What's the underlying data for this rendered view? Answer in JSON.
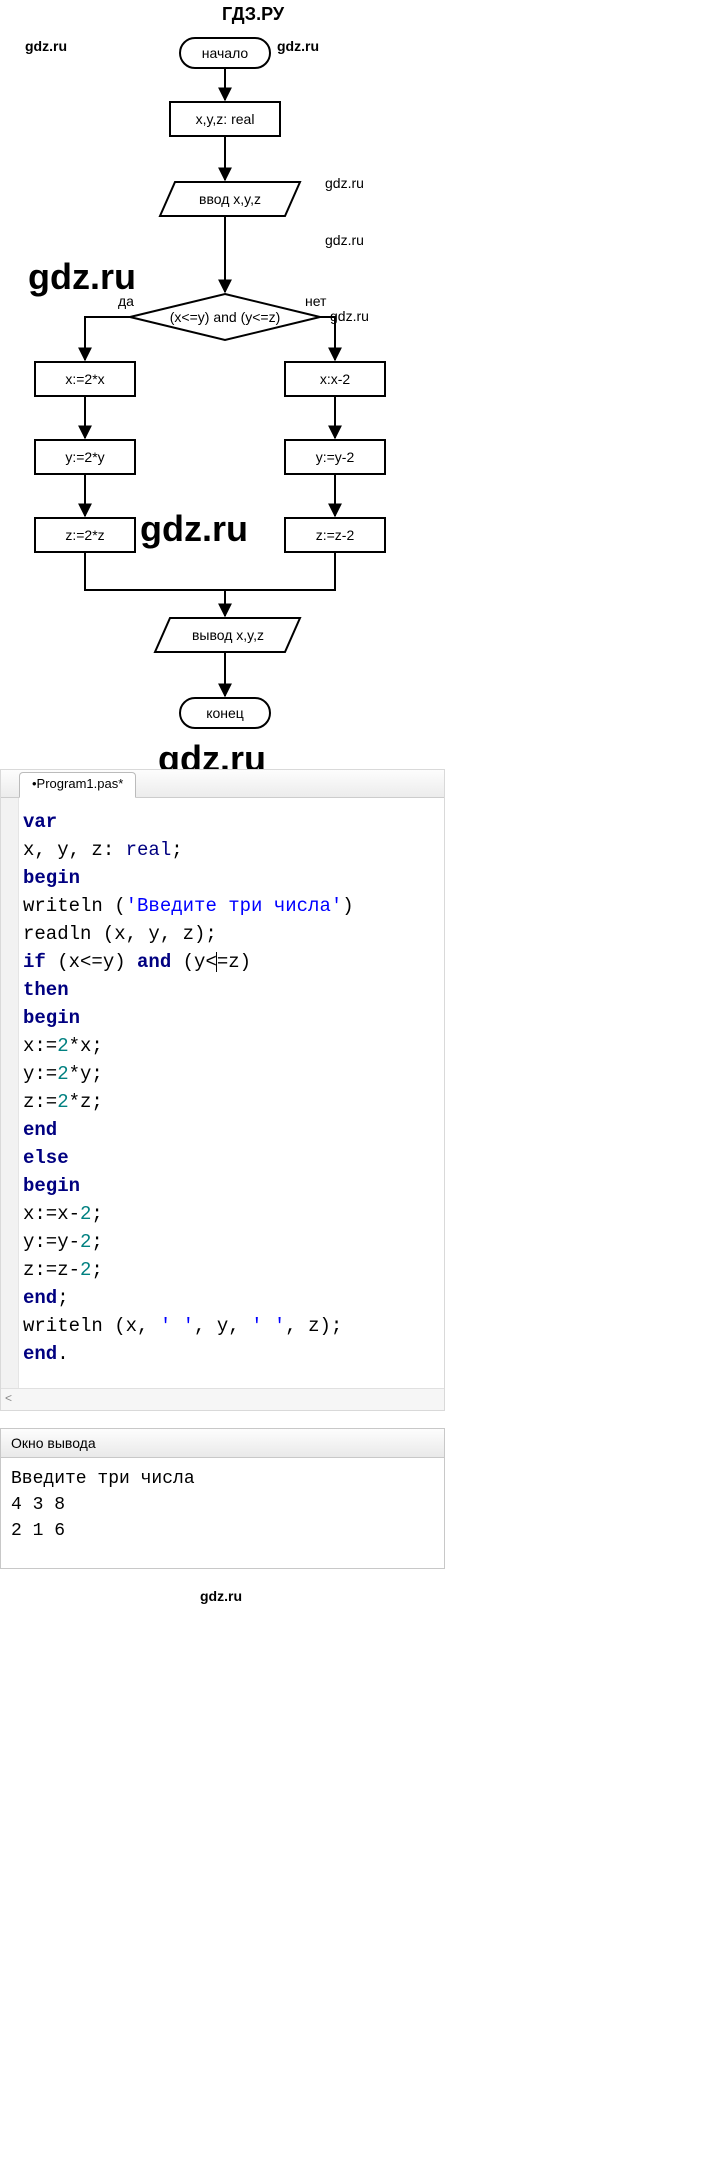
{
  "header": "ГДЗ.РУ",
  "watermarks": {
    "small": "gdz.ru",
    "big": "gdz.ru"
  },
  "flowchart": {
    "start": "начало",
    "decl": "x,y,z: real",
    "input": "ввод x,y,z",
    "cond": "(x<=y) and (y<=z)",
    "yes": "да",
    "no": "нет",
    "yes_branch": [
      "x:=2*x",
      "y:=2*y",
      "z:=2*z"
    ],
    "no_branch": [
      "x:x-2",
      "y:=y-2",
      "z:=z-2"
    ],
    "output": "вывод x,y,z",
    "end": "конец"
  },
  "editor": {
    "tab": "•Program1.pas*",
    "lines": [
      {
        "t": "kw",
        "v": "var"
      },
      {
        "t": "plain",
        "v": "x, y, z: ",
        "tail_ty": "real",
        "tail": ";"
      },
      {
        "t": "kw",
        "v": "begin"
      },
      {
        "t": "plain",
        "v": "writeln (",
        "str": "'Введите три числа'",
        "tail": ")"
      },
      {
        "t": "plain",
        "v": "readln (x, y, z);"
      },
      {
        "t": "if",
        "v": "if",
        "mid": " (x<=y) ",
        "and": "and",
        "mid2": " (y<|",
        "mid3": "=z)"
      },
      {
        "t": "kw",
        "v": "then"
      },
      {
        "t": "kw",
        "v": "begin"
      },
      {
        "t": "assign",
        "v": "x:=",
        "n": "2",
        "tail": "*x;"
      },
      {
        "t": "assign",
        "v": "y:=",
        "n": "2",
        "tail": "*y;"
      },
      {
        "t": "assign",
        "v": "z:=",
        "n": "2",
        "tail": "*z;"
      },
      {
        "t": "kw",
        "v": "end"
      },
      {
        "t": "kw",
        "v": "else"
      },
      {
        "t": "kw",
        "v": "begin"
      },
      {
        "t": "assign",
        "v": "x:=x-",
        "n": "2",
        "tail": ";"
      },
      {
        "t": "assign",
        "v": "y:=y-",
        "n": "2",
        "tail": ";"
      },
      {
        "t": "assign",
        "v": "z:=z-",
        "n": "2",
        "tail": ";"
      },
      {
        "t": "kwsemi",
        "v": "end",
        ";": ";"
      },
      {
        "t": "wr",
        "v": "writeln (x, ",
        "s1": "' '",
        "m1": ", y, ",
        "s2": "' '",
        "m2": ", z);"
      },
      {
        "t": "kwdot",
        "v": "end",
        "dot": "."
      }
    ]
  },
  "output": {
    "title": "Окно вывода",
    "lines": [
      "Введите три числа",
      "4 3 8",
      "2 1 6"
    ]
  },
  "scroll_hint": "<",
  "chart_data": {
    "type": "flowchart",
    "nodes": [
      {
        "id": "start",
        "kind": "terminator",
        "label": "начало"
      },
      {
        "id": "decl",
        "kind": "process",
        "label": "x,y,z: real"
      },
      {
        "id": "in",
        "kind": "io",
        "label": "ввод x,y,z"
      },
      {
        "id": "cond",
        "kind": "decision",
        "label": "(x<=y) and (y<=z)"
      },
      {
        "id": "y1",
        "kind": "process",
        "label": "x:=2*x"
      },
      {
        "id": "y2",
        "kind": "process",
        "label": "y:=2*y"
      },
      {
        "id": "y3",
        "kind": "process",
        "label": "z:=2*z"
      },
      {
        "id": "n1",
        "kind": "process",
        "label": "x:x-2"
      },
      {
        "id": "n2",
        "kind": "process",
        "label": "y:=y-2"
      },
      {
        "id": "n3",
        "kind": "process",
        "label": "z:=z-2"
      },
      {
        "id": "out",
        "kind": "io",
        "label": "вывод x,y,z"
      },
      {
        "id": "end",
        "kind": "terminator",
        "label": "конец"
      }
    ],
    "edges": [
      {
        "from": "start",
        "to": "decl"
      },
      {
        "from": "decl",
        "to": "in"
      },
      {
        "from": "in",
        "to": "cond"
      },
      {
        "from": "cond",
        "to": "y1",
        "label": "да"
      },
      {
        "from": "cond",
        "to": "n1",
        "label": "нет"
      },
      {
        "from": "y1",
        "to": "y2"
      },
      {
        "from": "y2",
        "to": "y3"
      },
      {
        "from": "n1",
        "to": "n2"
      },
      {
        "from": "n2",
        "to": "n3"
      },
      {
        "from": "y3",
        "to": "out"
      },
      {
        "from": "n3",
        "to": "out"
      },
      {
        "from": "out",
        "to": "end"
      }
    ]
  }
}
